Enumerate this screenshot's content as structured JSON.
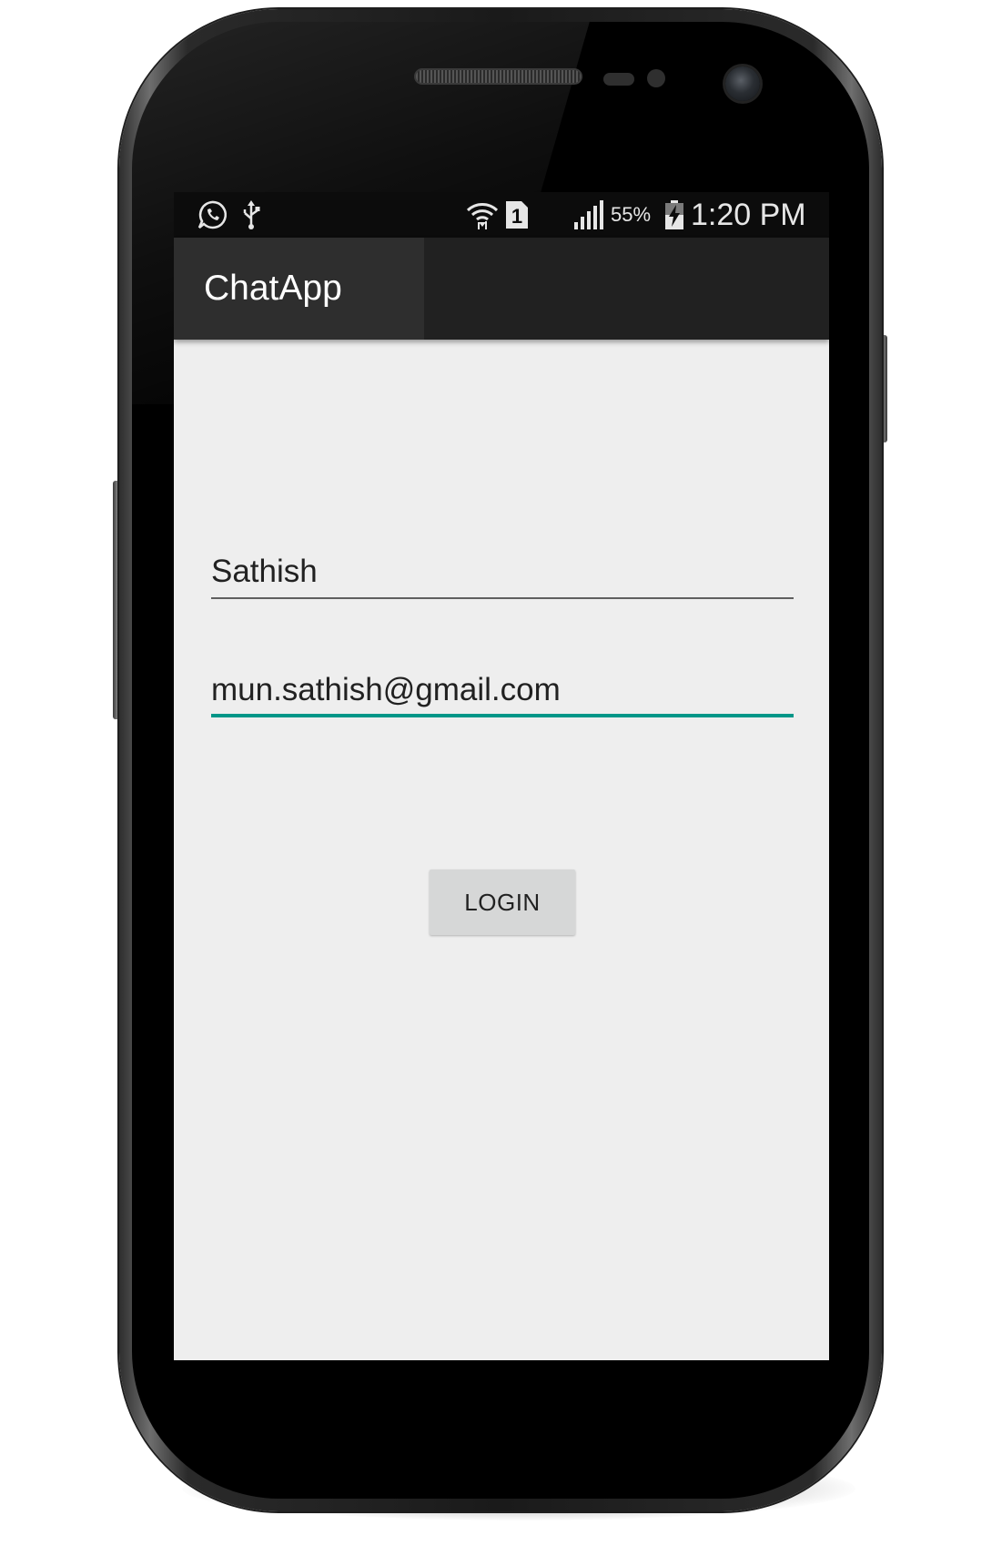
{
  "status_bar": {
    "icons": [
      "whatsapp-icon",
      "usb-icon",
      "wifi-icon",
      "sim-1-icon",
      "signal-icon",
      "battery-charging-icon"
    ],
    "sim_slot": "1",
    "battery_percent": "55%",
    "time": "1:20 PM"
  },
  "action_bar": {
    "title": "ChatApp"
  },
  "form": {
    "name_value": "Sathish",
    "email_value": "mun.sathish@gmail.com",
    "login_label": "LOGIN",
    "accent_color": "#009688"
  }
}
